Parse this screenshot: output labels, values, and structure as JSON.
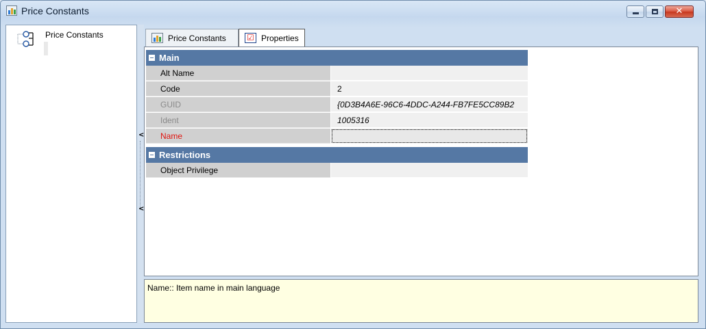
{
  "window": {
    "title": "Price Constants",
    "icon": "chart-app-icon",
    "controls": [
      "minimize-icon",
      "maximize-icon",
      "close-icon"
    ],
    "close_glyph": "✕"
  },
  "tree": {
    "root_label": "Price Constants",
    "root_icon": "hierarchy-icon"
  },
  "splitter": {
    "arrow_top": "<",
    "arrow_bottom": "<"
  },
  "tabs": [
    {
      "label": "Price Constants",
      "icon": "chart-app-icon",
      "active": false
    },
    {
      "label": "Properties",
      "icon": "properties-icon",
      "active": true
    }
  ],
  "properties": {
    "categories": [
      {
        "label": "Main",
        "rows": [
          {
            "name": "Alt Name",
            "value": ""
          },
          {
            "name": "Code",
            "value": "2"
          },
          {
            "name": "GUID",
            "value": "{0D3B4A6E-96C6-4DDC-A244-FB7FE5CC89B2"
          },
          {
            "name": "Ident",
            "value": "1005316"
          },
          {
            "name": "Name",
            "value": ""
          }
        ]
      },
      {
        "label": "Restrictions",
        "rows": [
          {
            "name": "Object Privilege",
            "value": ""
          }
        ]
      }
    ]
  },
  "description": "Name:: Item name in main language",
  "colors": {
    "category_header": "#5578a4",
    "required_label": "#e0140e",
    "description_bg": "#ffffe2"
  }
}
